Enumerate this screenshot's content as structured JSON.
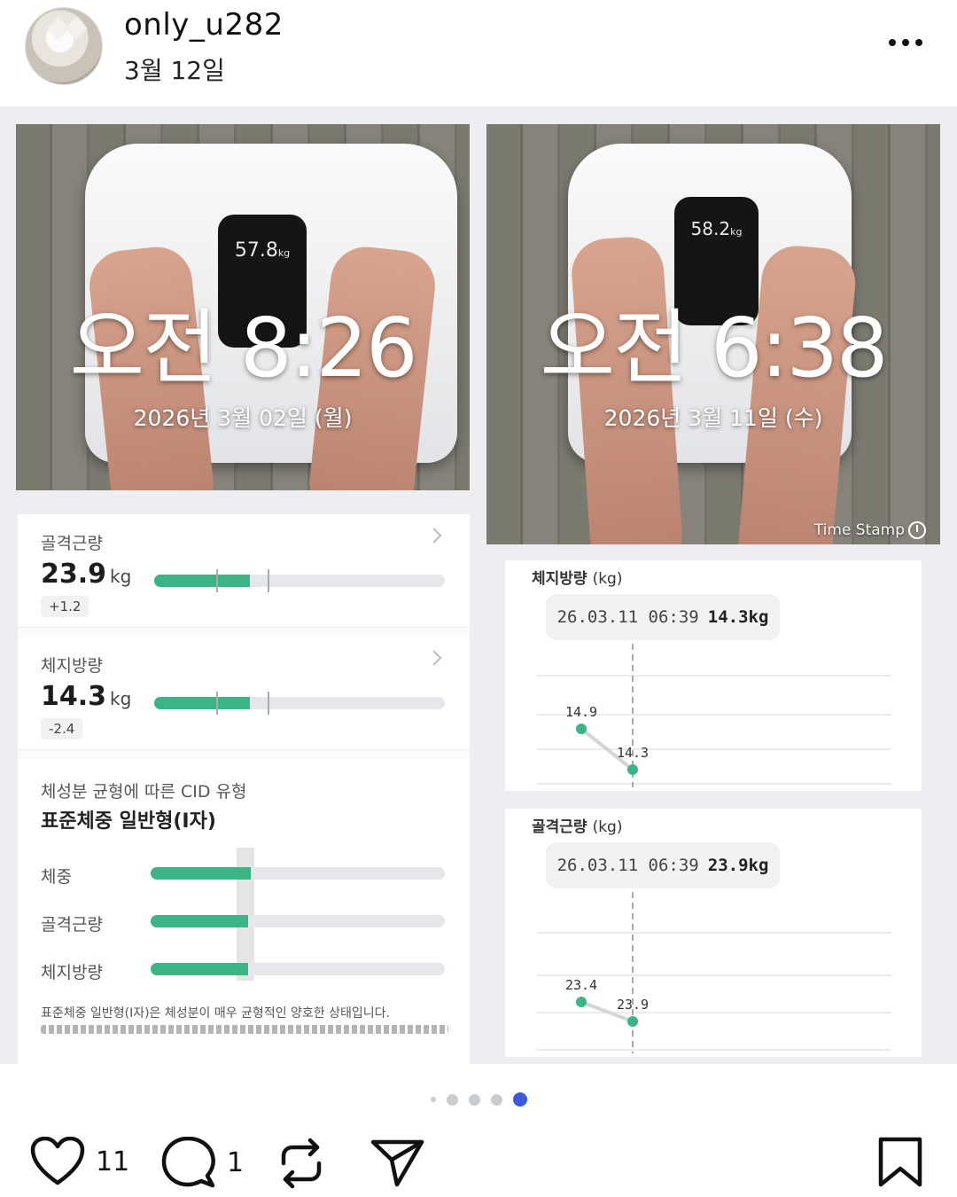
{
  "post": {
    "username": "only_u282",
    "date": "3월 12일"
  },
  "photos": [
    {
      "scale_reading": "57.8",
      "scale_unit": "kg",
      "time_stamp": "오전 8:26",
      "date_stamp": "2026년 3월 02일 (월)"
    },
    {
      "scale_reading": "58.2",
      "scale_unit": "kg",
      "time_stamp": "오전 6:38",
      "date_stamp": "2026년 3월 11일 (수)",
      "watermark": "Time Stamp"
    }
  ],
  "body_composition": {
    "metrics": [
      {
        "label": "골격근량",
        "value": "23.9",
        "unit": "kg",
        "delta": "+1.2",
        "fill_fraction": 0.33
      },
      {
        "label": "체지방량",
        "value": "14.3",
        "unit": "kg",
        "delta": "-2.4",
        "fill_fraction": 0.33
      }
    ],
    "cid": {
      "title": "체성분 균형에 따른 CID 유형",
      "type": "표준체중 일반형(I자)",
      "rows": [
        {
          "label": "체중",
          "fill_fraction": 0.34
        },
        {
          "label": "골격근량",
          "fill_fraction": 0.33
        },
        {
          "label": "체지방량",
          "fill_fraction": 0.33
        }
      ],
      "description": "표준체중 일반형(I자)은 체성분이 매우 균형적인 양호한 상태입니다."
    }
  },
  "chart_data": [
    {
      "type": "line",
      "title": "체지방량",
      "unit": "(kg)",
      "tooltip": {
        "datetime": "26.03.11 06:39",
        "value": "14.3kg"
      },
      "points": [
        {
          "label": "14.9",
          "y": 14.9
        },
        {
          "label": "14.3",
          "y": 14.3
        }
      ],
      "point_color": "#3bb585"
    },
    {
      "type": "line",
      "title": "골격근량",
      "unit": "(kg)",
      "tooltip": {
        "datetime": "26.03.11 06:39",
        "value": "23.9kg"
      },
      "points": [
        {
          "label": "23.4",
          "y": 23.4
        },
        {
          "label": "23.9",
          "y": 23.9
        }
      ],
      "point_color": "#3bb585"
    }
  ],
  "carousel": {
    "total": 5,
    "active_index": 4,
    "active_color": "#3b5bdb"
  },
  "actions": {
    "likes": "11",
    "comments": "1"
  }
}
